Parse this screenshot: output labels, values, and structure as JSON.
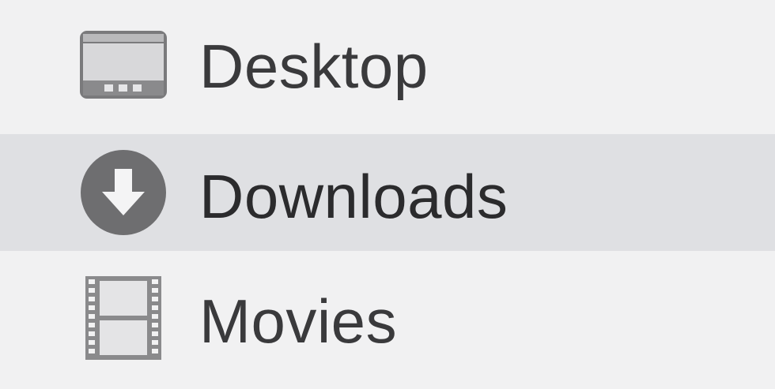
{
  "sidebar": {
    "items": [
      {
        "label": "Desktop",
        "icon": "desktop-icon",
        "selected": false
      },
      {
        "label": "Downloads",
        "icon": "downloads-icon",
        "selected": true
      },
      {
        "label": "Movies",
        "icon": "movies-icon",
        "selected": false
      }
    ]
  },
  "colors": {
    "background": "#f1f1f2",
    "selected_row": "#dfe0e3",
    "icon_gray": "#6e6e70",
    "text": "#3a3a3c"
  }
}
